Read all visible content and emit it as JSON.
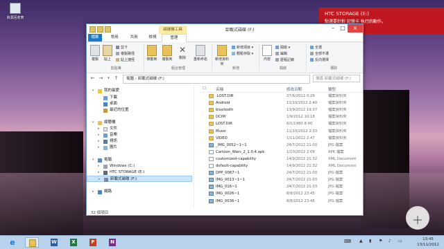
{
  "desktop": {
    "icon_label": "資源回收筒"
  },
  "toast": {
    "title": "HTC STORAGE (E:)",
    "message": "點選要針對 記憶卡 執行的動作。"
  },
  "window": {
    "title": "卸載式磁碟 (F:)",
    "context_tab": "磁碟機工具",
    "tabs": [
      "檔案",
      "常用",
      "共用",
      "檢視",
      "管理"
    ],
    "ribbon": {
      "clipboard": {
        "label": "剪貼簿",
        "copy": "複製",
        "paste": "貼上",
        "cut": "剪下",
        "copy_path": "複製路徑",
        "paste_shortcut": "貼上捷徑"
      },
      "organize": {
        "label": "組合管理",
        "move_to": "移動到",
        "copy_to": "複製到",
        "delete": "刪除",
        "rename": "重新命名"
      },
      "new": {
        "label": "新增",
        "new_folder": "新增資料夾",
        "new_item": "新增項目 ▾",
        "easy_access": "輕鬆存取 ▾"
      },
      "open": {
        "label": "開啟",
        "properties": "內容",
        "open": "開啟 ▾",
        "edit": "編輯",
        "history": "歷程記錄"
      },
      "select": {
        "label": "選取",
        "select_all": "全選",
        "select_none": "全部不選",
        "invert": "反向選擇"
      }
    },
    "address": {
      "path": "電腦  ›  卸載式磁碟 (F:)",
      "search_placeholder": "搜尋 卸載式磁碟 (F:)"
    },
    "sidebar": {
      "favorites": "我的最愛",
      "fav_items": [
        "下載",
        "桌面",
        "最近的位置"
      ],
      "libraries": "媒體櫃",
      "lib_items": [
        "文件",
        "音樂",
        "視訊",
        "圖片"
      ],
      "computer": "電腦",
      "drives": [
        "Windows (C:)",
        "HTC STORAGE (E:)",
        "卸載式磁碟 (F:)"
      ],
      "network": "網路"
    },
    "columns": {
      "name": "名稱",
      "date": "修改日期",
      "type": "類型"
    },
    "files": [
      {
        "name": ".LOST.DIR",
        "date": "27/6/2012 0:29",
        "type": "檔案資料夾",
        "kind": "folder"
      },
      {
        "name": "Android",
        "date": "11/10/2012 2:40",
        "type": "檔案資料夾",
        "kind": "folder"
      },
      {
        "name": "bluetooth",
        "date": "13/9/2012 19:37",
        "type": "檔案資料夾",
        "kind": "folder"
      },
      {
        "name": "DCIM",
        "date": "1/9/2012 10:18",
        "type": "檔案資料夾",
        "kind": "folder"
      },
      {
        "name": "LOST.DIR",
        "date": "6/1/1980 8:00",
        "type": "檔案資料夾",
        "kind": "folder"
      },
      {
        "name": "Music",
        "date": "11/10/2012 2:33",
        "type": "檔案資料夾",
        "kind": "folder"
      },
      {
        "name": "VIDEO",
        "date": "1/11/2012 2:47",
        "type": "檔案資料夾",
        "kind": "folder"
      },
      {
        "name": "_IMG_0052~1~1",
        "date": "24/7/2012 21:03",
        "type": "JPG 檔案",
        "kind": "image"
      },
      {
        "name": "Cartoon_Wars_2_1.0.4.apk",
        "date": "1/10/2012 2:09",
        "type": "APK 檔案",
        "kind": "file"
      },
      {
        "name": "customized-capability",
        "date": "14/9/2012 21:32",
        "type": "XML Document",
        "kind": "file"
      },
      {
        "name": "default-capability",
        "date": "14/9/2012 21:32",
        "type": "XML Document",
        "kind": "file"
      },
      {
        "name": "DPP_0067~1",
        "date": "24/7/2012 21:03",
        "type": "JPG 檔案",
        "kind": "image"
      },
      {
        "name": "IMG_0013~1~1",
        "date": "24/7/2012 21:03",
        "type": "JPG 檔案",
        "kind": "image"
      },
      {
        "name": "IMG_016~1",
        "date": "24/7/2012 21:03",
        "type": "JPG 檔案",
        "kind": "image"
      },
      {
        "name": "IMG_0026~1",
        "date": "8/8/2012 23:45",
        "type": "JPG 檔案",
        "kind": "image"
      },
      {
        "name": "IMG_0036~1",
        "date": "8/8/2012 23:45",
        "type": "JPG 檔案",
        "kind": "image"
      }
    ],
    "status": "32 個項目"
  },
  "taskbar": {
    "time": "13:45",
    "date": "13/11/2012"
  },
  "colors": {
    "toast_bg": "#c1181f",
    "ribbon_file_tab": "#1979ca",
    "taskbar": "#b8d2ec",
    "folder": "#e8c15c"
  }
}
